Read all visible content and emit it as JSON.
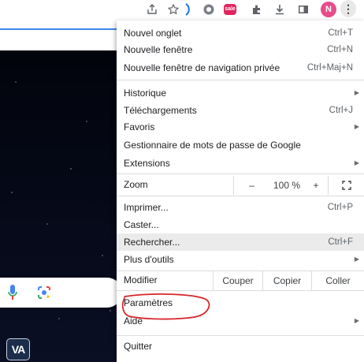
{
  "toolbar": {
    "icons": [
      "share-icon",
      "bookmark-star-icon",
      "extension-icon",
      "red-extension-icon",
      "puzzle-icon",
      "download-icon",
      "side-panel-icon",
      "profile-avatar",
      "kebab-menu-icon"
    ],
    "red_extension_label": "sale",
    "avatar_initial": "N",
    "kebab_glyph": "⋮"
  },
  "app_tile_label": "VA",
  "menu": {
    "new_tab": {
      "label": "Nouvel onglet",
      "shortcut": "Ctrl+T"
    },
    "new_window": {
      "label": "Nouvelle fenêtre",
      "shortcut": "Ctrl+N"
    },
    "new_incognito": {
      "label": "Nouvelle fenêtre de navigation privée",
      "shortcut": "Ctrl+Maj+N"
    },
    "history": {
      "label": "Historique"
    },
    "downloads": {
      "label": "Téléchargements",
      "shortcut": "Ctrl+J"
    },
    "bookmarks": {
      "label": "Favoris"
    },
    "password_manager": {
      "label": "Gestionnaire de mots de passe de Google"
    },
    "extensions": {
      "label": "Extensions"
    },
    "zoom": {
      "label": "Zoom",
      "minus": "–",
      "value": "100 %",
      "plus": "+"
    },
    "print": {
      "label": "Imprimer...",
      "shortcut": "Ctrl+P"
    },
    "cast": {
      "label": "Caster..."
    },
    "find": {
      "label": "Rechercher...",
      "shortcut": "Ctrl+F"
    },
    "more_tools": {
      "label": "Plus d'outils"
    },
    "edit": {
      "label": "Modifier",
      "cut": "Couper",
      "copy": "Copier",
      "paste": "Coller"
    },
    "settings": {
      "label": "Paramètres"
    },
    "help": {
      "label": "Aide"
    },
    "quit": {
      "label": "Quitter"
    }
  },
  "annotation_color": "#d9262c",
  "accent_color": "#1a73e8"
}
